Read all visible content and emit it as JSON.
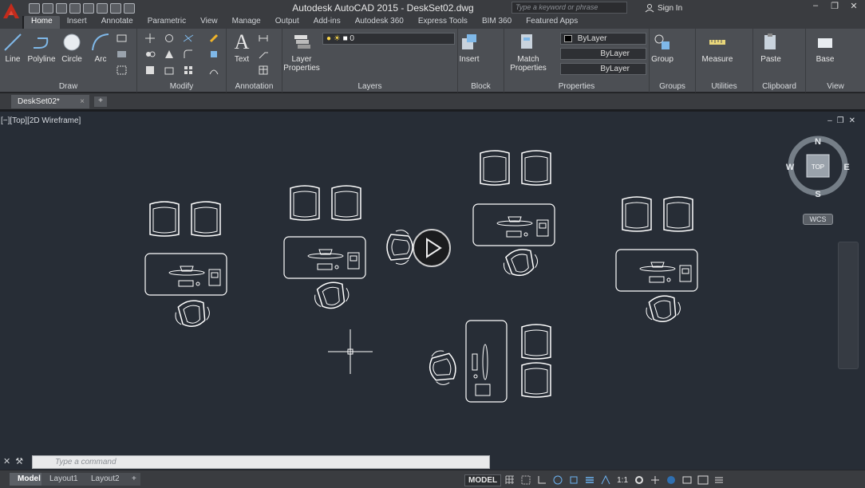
{
  "window": {
    "title": "Autodesk AutoCAD 2015 - DeskSet02.dwg",
    "search_placeholder": "Type a keyword or phrase",
    "signin_label": "Sign In",
    "controls": [
      "minimize",
      "restore",
      "close"
    ]
  },
  "ribbon_tabs": [
    {
      "label": "Home",
      "active": true
    },
    {
      "label": "Insert"
    },
    {
      "label": "Annotate"
    },
    {
      "label": "Parametric"
    },
    {
      "label": "View"
    },
    {
      "label": "Manage"
    },
    {
      "label": "Output"
    },
    {
      "label": "Add-ins"
    },
    {
      "label": "Autodesk 360"
    },
    {
      "label": "Express Tools"
    },
    {
      "label": "BIM 360"
    },
    {
      "label": "Featured Apps"
    }
  ],
  "ribbon": {
    "draw": {
      "title": "Draw",
      "tools": [
        "Line",
        "Polyline",
        "Circle",
        "Arc"
      ]
    },
    "modify": {
      "title": "Modify"
    },
    "annotation": {
      "title": "Annotation",
      "text_tool": "Text"
    },
    "layers": {
      "title": "Layers",
      "layer_properties": "Layer Properties",
      "current_layer": "0"
    },
    "block": {
      "title": "Block",
      "insert_tool": "Insert"
    },
    "properties": {
      "title": "Properties",
      "match_properties": "Match Properties",
      "color": "ByLayer",
      "linetype": "ByLayer",
      "lineweight": "ByLayer"
    },
    "groups": {
      "title": "Groups",
      "group_tool": "Group"
    },
    "utilities": {
      "title": "Utilities",
      "measure_tool": "Measure"
    },
    "clipboard": {
      "title": "Clipboard",
      "paste_tool": "Paste"
    },
    "view": {
      "title": "View",
      "base_tool": "Base"
    }
  },
  "document_tab": {
    "label": "DeskSet02*"
  },
  "viewport": {
    "label": "[−][Top][2D Wireframe]",
    "viewcube": {
      "north": "N",
      "south": "S",
      "east": "E",
      "west": "W",
      "face": "TOP"
    },
    "wcs_label": "WCS"
  },
  "command_line": {
    "placeholder": "Type a command"
  },
  "layout_tabs": [
    {
      "label": "Model",
      "active": true
    },
    {
      "label": "Layout1"
    },
    {
      "label": "Layout2"
    }
  ],
  "status": {
    "space": "MODEL",
    "scale": "1:1"
  },
  "colors": {
    "background": "#272d36",
    "ribbon": "#4c4f54",
    "accent": "#c42b1c",
    "drawing_lines": "#ffffff"
  }
}
